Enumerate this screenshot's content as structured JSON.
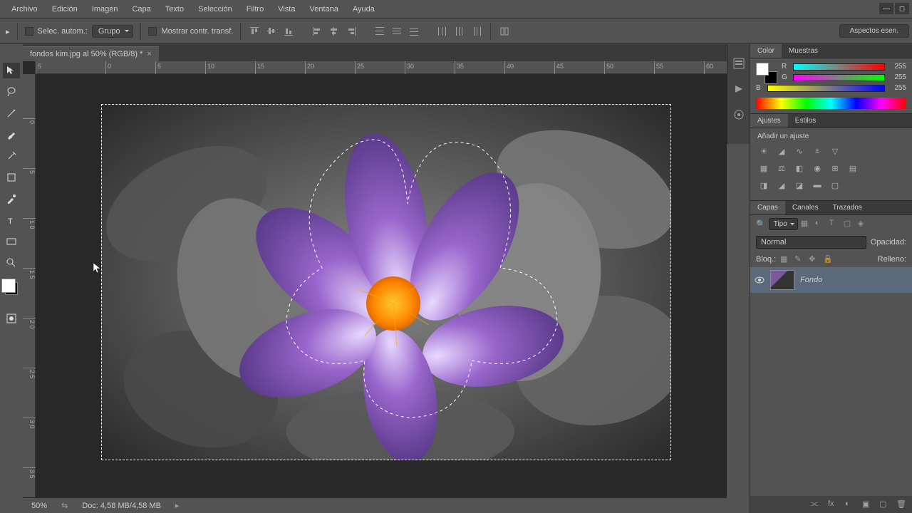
{
  "menu": {
    "items": [
      "Archivo",
      "Edición",
      "Imagen",
      "Capa",
      "Texto",
      "Selección",
      "Filtro",
      "Vista",
      "Ventana",
      "Ayuda"
    ]
  },
  "options": {
    "autoSelectLabel": "Selec. autom.:",
    "groupLabel": "Grupo",
    "showTransformLabel": "Mostrar contr. transf."
  },
  "workspace": "Aspectos esen.",
  "tab": {
    "title": "fondos kim.jpg al 50% (RGB/8) *"
  },
  "ruler": {
    "h": [
      "5",
      "0",
      "5",
      "10",
      "15",
      "20",
      "25",
      "30",
      "35",
      "40",
      "45",
      "50",
      "55",
      "60"
    ],
    "v": [
      "0",
      "5",
      "1 0",
      "1 5",
      "2 0",
      "2 5",
      "3 0",
      "3 5"
    ]
  },
  "status": {
    "zoom": "50%",
    "doc": "Doc: 4,58 MB/4,58 MB"
  },
  "panels": {
    "colorTabs": [
      "Color",
      "Muestras"
    ],
    "rgb": {
      "r": "255",
      "g": "255",
      "b": "255",
      "labels": [
        "R",
        "G",
        "B"
      ]
    },
    "adjTabs": [
      "Ajustes",
      "Estilos"
    ],
    "adjTitle": "Añadir un ajuste",
    "layerTabs": [
      "Capas",
      "Canales",
      "Trazados"
    ],
    "layerKind": "Tipo",
    "blendMode": "Normal",
    "opacityLabel": "Opacidad:",
    "lockLabel": "Bloq.:",
    "fillLabel": "Relleno:",
    "layerName": "Fondo"
  }
}
